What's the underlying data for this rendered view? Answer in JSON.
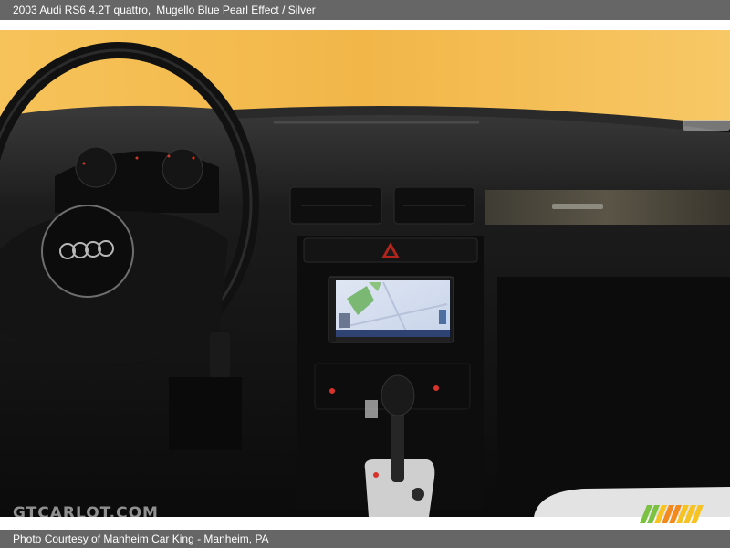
{
  "header": {
    "vehicle": "2003 Audi RS6 4.2T quattro,",
    "color": "Mugello Blue Pearl Effect / Silver"
  },
  "watermark": {
    "text": "GTCARLOT.COM"
  },
  "footer": {
    "credit": "Photo Courtesy of Manheim Car King - Manheim, PA"
  },
  "colors": {
    "bar": "#666666",
    "wall": "#f3b94a",
    "dashboard": "#1a1a1a",
    "stripe_green": "#7cc242",
    "stripe_yellow": "#f7c323",
    "stripe_orange": "#f28a1e"
  },
  "icons": [
    "steering-wheel",
    "audi-rings-logo",
    "hazard-button-icon",
    "navigation-screen",
    "gear-shifter"
  ]
}
